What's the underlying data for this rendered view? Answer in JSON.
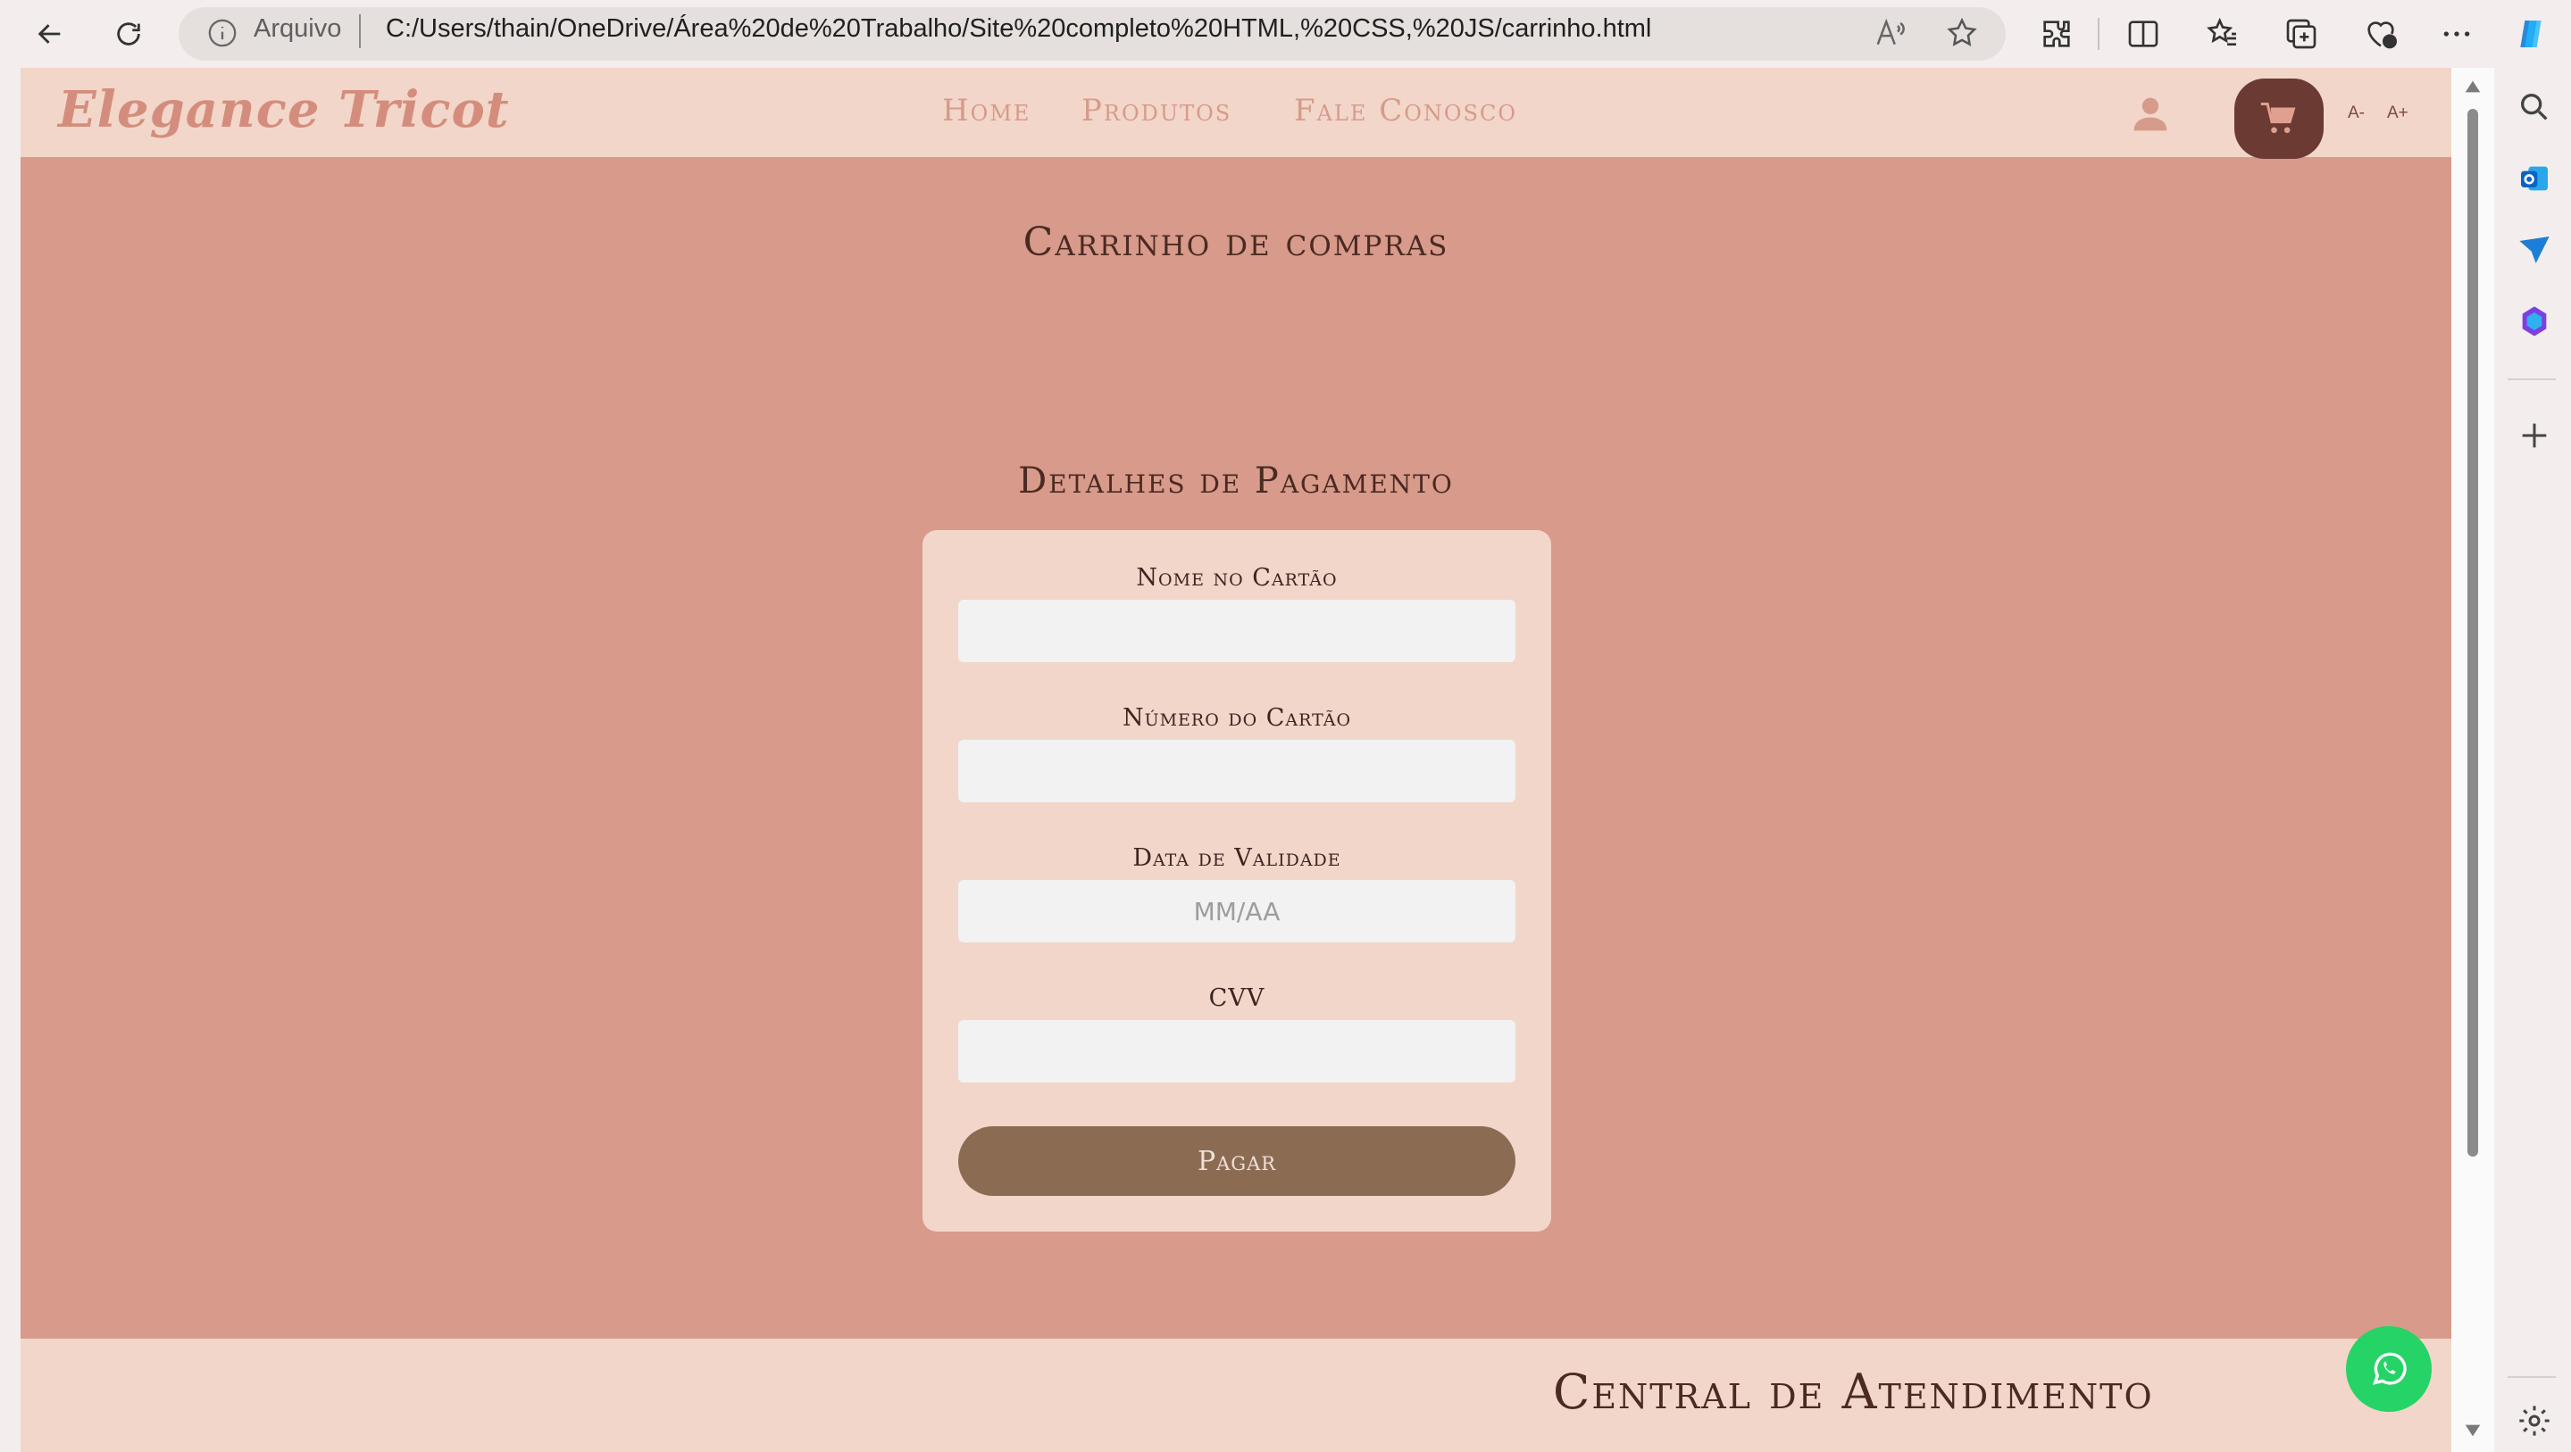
{
  "browser": {
    "address_scheme": "Arquivo",
    "url": "C:/Users/thain/OneDrive/Área%20de%20Trabalho/Site%20completo%20HTML,%20CSS,%20JS/carrinho.html"
  },
  "site": {
    "logo": "Elegance Tricot",
    "nav": [
      "Home",
      "Produtos",
      "Fale Conosco"
    ],
    "font_decrease": "A-",
    "font_increase": "A+",
    "colors": {
      "header_bg": "#f2d6c9",
      "page_bg": "#d89a8a",
      "cart_button": "#6b3a32",
      "pay_button": "#8b6c53",
      "whatsapp": "#25d366"
    }
  },
  "main": {
    "cart_title": "Carrinho de compras",
    "payment_title": "Detalhes de Pagamento",
    "form": {
      "card_name_label": "Nome no Cartão",
      "card_name_value": "",
      "card_number_label": "Número do Cartão",
      "card_number_value": "",
      "expiry_label": "Data de Validade",
      "expiry_placeholder": "MM/AA",
      "cvv_label": "CVV",
      "cvv_value": "",
      "submit_label": "Pagar"
    }
  },
  "footer": {
    "title": "Central de Atendimento"
  }
}
